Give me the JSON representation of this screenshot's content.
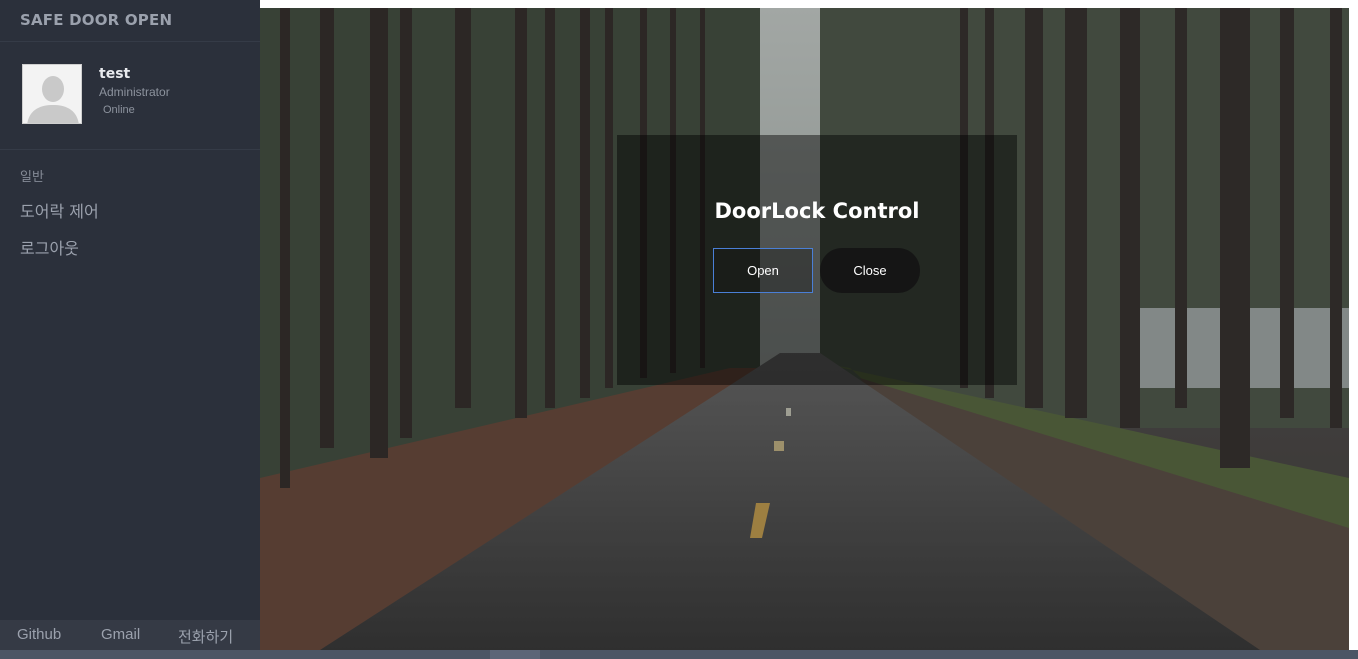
{
  "sidebar": {
    "brand": "SAFE DOOR OPEN",
    "user": {
      "name": "test",
      "role": "Administrator",
      "status": "Online"
    },
    "section_label": "일반",
    "menu": [
      {
        "label": "도어락 제어"
      },
      {
        "label": "로그아웃"
      }
    ],
    "footer_links": [
      {
        "label": "Github"
      },
      {
        "label": "Gmail"
      },
      {
        "label": "전화하기"
      }
    ]
  },
  "panel": {
    "title": "DoorLock Control",
    "open_label": "Open",
    "close_label": "Close"
  },
  "colors": {
    "sidebar_bg": "#2b303b",
    "open_border": "#4a7fd6",
    "close_bg": "#151515"
  }
}
